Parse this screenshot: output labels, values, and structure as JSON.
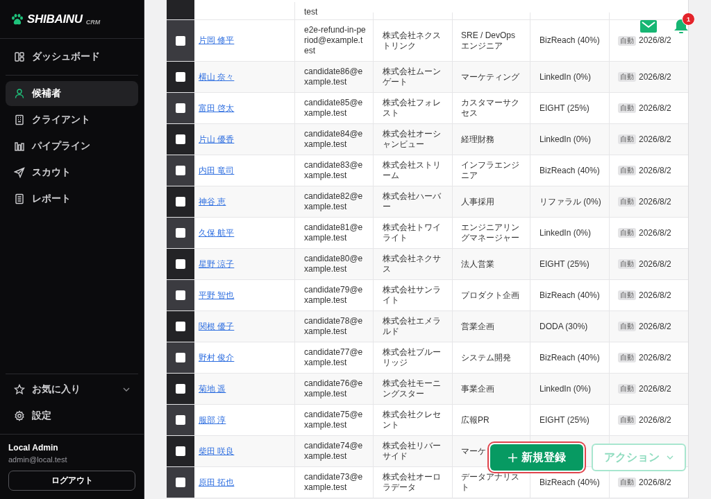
{
  "brand": {
    "name": "SHIBAINU",
    "sub": "CRM"
  },
  "nav": [
    {
      "label": "ダッシュボード",
      "selected": false
    },
    {
      "label": "候補者",
      "selected": true
    },
    {
      "label": "クライアント",
      "selected": false
    },
    {
      "label": "パイプライン",
      "selected": false
    },
    {
      "label": "スカウト",
      "selected": false
    },
    {
      "label": "レポート",
      "selected": false
    }
  ],
  "favorites": {
    "label": "お気に入り",
    "expanded": false
  },
  "settings": {
    "label": "設定"
  },
  "user": {
    "name": "Local Admin",
    "email": "admin@local.test",
    "logout": "ログアウト"
  },
  "notifications": {
    "count": "1"
  },
  "partial_row": {
    "email": "test"
  },
  "rows": [
    {
      "name": "片岡 修平",
      "email": "e2e-refund-in-period@example.test",
      "company": "株式会社ネクストリンク",
      "position": "SRE / DevOps エンジニア",
      "source": "BizReach (40%)",
      "tag": "自動",
      "date": "2026/8/2",
      "checked": false
    },
    {
      "name": "横山 奈々",
      "email": "candidate86@example.test",
      "company": "株式会社ムーンゲート",
      "position": "マーケティング",
      "source": "LinkedIn (0%)",
      "tag": "自動",
      "date": "2026/8/2",
      "checked": false
    },
    {
      "name": "富田 啓太",
      "email": "candidate85@example.test",
      "company": "株式会社フォレスト",
      "position": "カスタマーサクセス",
      "source": "EIGHT (25%)",
      "tag": "自動",
      "date": "2026/8/2",
      "checked": false
    },
    {
      "name": "片山 優香",
      "email": "candidate84@example.test",
      "company": "株式会社オーシャンビュー",
      "position": "経理財務",
      "source": "LinkedIn (0%)",
      "tag": "自動",
      "date": "2026/8/2",
      "checked": false
    },
    {
      "name": "内田 竜司",
      "email": "candidate83@example.test",
      "company": "株式会社ストリーム",
      "position": "インフラエンジニア",
      "source": "BizReach (40%)",
      "tag": "自動",
      "date": "2026/8/2",
      "checked": false
    },
    {
      "name": "神谷 恵",
      "email": "candidate82@example.test",
      "company": "株式会社ハーバー",
      "position": "人事採用",
      "source": "リファラル (0%)",
      "tag": "自動",
      "date": "2026/8/2",
      "checked": false
    },
    {
      "name": "久保 航平",
      "email": "candidate81@example.test",
      "company": "株式会社トワイライト",
      "position": "エンジニアリングマネージャー",
      "source": "LinkedIn (0%)",
      "tag": "自動",
      "date": "2026/8/2",
      "checked": false
    },
    {
      "name": "星野 涼子",
      "email": "candidate80@example.test",
      "company": "株式会社ネクサス",
      "position": "法人営業",
      "source": "EIGHT (25%)",
      "tag": "自動",
      "date": "2026/8/2",
      "checked": false
    },
    {
      "name": "平野 智也",
      "email": "candidate79@example.test",
      "company": "株式会社サンライト",
      "position": "プロダクト企画",
      "source": "BizReach (40%)",
      "tag": "自動",
      "date": "2026/8/2",
      "checked": false
    },
    {
      "name": "関根 優子",
      "email": "candidate78@example.test",
      "company": "株式会社エメラルド",
      "position": "営業企画",
      "source": "DODA (30%)",
      "tag": "自動",
      "date": "2026/8/2",
      "checked": false
    },
    {
      "name": "野村 俊介",
      "email": "candidate77@example.test",
      "company": "株式会社ブルーリッジ",
      "position": "システム開発",
      "source": "BizReach (40%)",
      "tag": "自動",
      "date": "2026/8/2",
      "checked": false
    },
    {
      "name": "菊地 遥",
      "email": "candidate76@example.test",
      "company": "株式会社モーニングスター",
      "position": "事業企画",
      "source": "LinkedIn (0%)",
      "tag": "自動",
      "date": "2026/8/2",
      "checked": false
    },
    {
      "name": "服部 淳",
      "email": "candidate75@example.test",
      "company": "株式会社クレセント",
      "position": "広報PR",
      "source": "EIGHT (25%)",
      "tag": "自動",
      "date": "2026/8/2",
      "checked": false
    },
    {
      "name": "柴田 咲良",
      "email": "candidate74@example.test",
      "company": "株式会社リバーサイド",
      "position": "マーケ",
      "checked": false
    },
    {
      "name": "原田 拓也",
      "email": "candidate73@example.test",
      "company": "株式会社オーロラデータ",
      "position": "データアナリスト",
      "source": "BizReach (40%)",
      "tag": "自動",
      "date": "2026/8/2",
      "checked": false
    }
  ],
  "actions": {
    "create": "新規登録",
    "more": "アクション"
  }
}
